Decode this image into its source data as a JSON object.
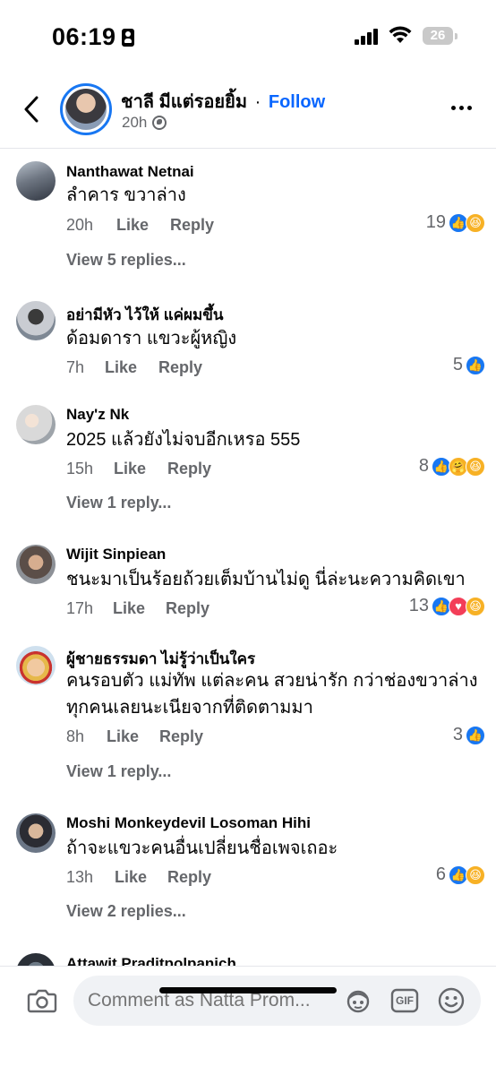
{
  "status_bar": {
    "time": "06:19",
    "battery": "26"
  },
  "header": {
    "page_name": "ชาลี มีแต่รอยยิ้ม",
    "separator": "·",
    "follow_label": "Follow",
    "post_time": "20h"
  },
  "comments": [
    {
      "author": "Nanthawat Netnai",
      "lines": [
        "ลำคาร  ขวาล่าง"
      ],
      "time": "20h",
      "like": "Like",
      "reply": "Reply",
      "react_count": "19",
      "reactions": [
        "like",
        "haha"
      ],
      "view_replies": "View 5 replies..."
    },
    {
      "author": "อย่ามีหัว ไว้ให้ แค่ผมขึ้น",
      "lines": [
        "ด้อมดารา แขวะผู้หญิง"
      ],
      "time": "7h",
      "like": "Like",
      "reply": "Reply",
      "react_count": "5",
      "reactions": [
        "like"
      ],
      "view_replies": ""
    },
    {
      "author": "Nay'z Nk",
      "lines": [
        "2025 แล้วยังไม่จบอีกเหรอ 555"
      ],
      "time": "15h",
      "like": "Like",
      "reply": "Reply",
      "react_count": "8",
      "reactions": [
        "like",
        "care",
        "haha"
      ],
      "view_replies": "View 1 reply..."
    },
    {
      "author": "Wijit Sinpiean",
      "lines": [
        "ชนะมาเป็นร้อยถ้วยเต็มบ้านไม่ดู นี่ล่ะนะความคิดเขา"
      ],
      "time": "17h",
      "like": "Like",
      "reply": "Reply",
      "react_count": "13",
      "reactions": [
        "like",
        "love",
        "haha"
      ],
      "view_replies": ""
    },
    {
      "author": "ผู้ชายธรรมดา ไม่รู้ว่าเป็นใคร",
      "lines": [
        "คนรอบตัว แม่ทัพ แต่ละคน สวยน่ารัก กว่าช่องขวาล่าง",
        "ทุกคนเลยนะเนียจากที่ติดตามมา"
      ],
      "time": "8h",
      "like": "Like",
      "reply": "Reply",
      "react_count": "3",
      "reactions": [
        "like"
      ],
      "view_replies": "View 1 reply..."
    },
    {
      "author": "Moshi Monkeydevil Losoman Hihi",
      "lines": [
        "ถ้าจะแขวะคนอื่นเปลี่ยนชื่อเพจเถอะ"
      ],
      "time": "13h",
      "like": "Like",
      "reply": "Reply",
      "react_count": "6",
      "reactions": [
        "like",
        "haha"
      ],
      "view_replies": "View 2 replies..."
    },
    {
      "author": "Attawit Praditpolpanich",
      "lines": [],
      "time": "",
      "like": "",
      "reply": "",
      "react_count": "",
      "reactions": [],
      "view_replies": ""
    }
  ],
  "composer": {
    "placeholder": "Comment as Natta Prom...",
    "gif_label": "GIF"
  },
  "icons": [
    "back-chevron-icon",
    "globe-icon",
    "more-icon",
    "camera-icon",
    "avatar-sticker-icon",
    "gif-icon",
    "emoji-icon"
  ],
  "colors": {
    "accent": "#0866ff",
    "like": "#1877f2",
    "haha": "#f7b125",
    "love": "#f33e58",
    "muted": "#65676b"
  }
}
